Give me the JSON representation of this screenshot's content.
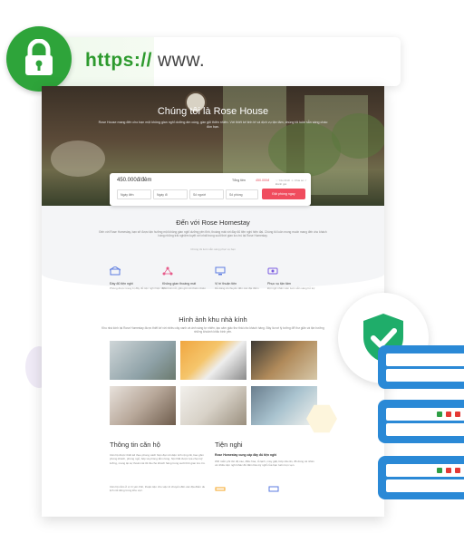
{
  "url_bar": {
    "scheme": "https://",
    "domain": "www.",
    "lock_icon": "lock-icon"
  },
  "hero": {
    "title": "Chúng tôi là Rose House",
    "subtitle": "Rose House mang đến cho bạn một không gian nghỉ dưỡng ấm cúng, gần gũi thiên nhiên. Với thiết kế tinh tế và dịch vụ tận tâm, chúng tôi luôn sẵn sàng chào đón bạn."
  },
  "booking": {
    "price": "450.000đ/đêm",
    "total_label": "Tổng tiền",
    "total_value": "450.000đ",
    "links": "♡ Yêu thích   ☺ Chia sẻ   ☆ Đánh giá",
    "fields": [
      "Ngày đến",
      "Ngày đi",
      "Số người",
      "Số phòng"
    ],
    "button": "Đặt phòng ngay"
  },
  "intro": {
    "title": "Đến với Rose Homestay",
    "text": "Đến với Rose Homestay, bạn sẽ được tận hưởng một không gian nghỉ dưỡng yên tĩnh, thoáng mát với đầy đủ tiện nghi hiện đại. Chúng tôi luôn mong muốn mang đến cho khách hàng những trải nghiệm tuyệt vời nhất trong suốt thời gian lưu trú tại Rose Homestay.",
    "note": "Chúng tôi luôn sẵn sàng phục vụ bạn"
  },
  "features": [
    {
      "title": "Đầy đủ tiện nghi",
      "desc": "Phòng được trang bị đầy đủ tiện nghi hiện đại"
    },
    {
      "title": "Không gian thoáng mát",
      "desc": "Thiết kế mở, gần gũi với thiên nhiên"
    },
    {
      "title": "Vị trí thuận tiện",
      "desc": "Dễ dàng di chuyển đến các địa điểm"
    },
    {
      "title": "Phục vụ tận tâm",
      "desc": "Đội ngũ nhân viên luôn sẵn sàng hỗ trợ"
    }
  ],
  "gallery": {
    "title": "Hình ảnh khu nhà kính",
    "text": "Khu nhà kính tại Rose Homestay được thiết kế với nhiều cây xanh và ánh sáng tự nhiên, tạo cảm giác thư thái cho khách hàng. Đây là nơi lý tưởng để thư giãn và tận hưởng những khoảnh khắc bình yên."
  },
  "info": {
    "title": "Thông tin căn hộ",
    "text": "Căn hộ được thiết kế theo phong cách hiện đại với diện tích rộng rãi, bao gồm phòng khách, phòng ngủ, bếp và phòng tắm riêng. Nội thất được lựa chọn kỹ lưỡng, mang lại sự thoải mái tối đa cho khách hàng trong suốt thời gian lưu trú.",
    "text2": "Căn hộ nằm ở vị trí yên tĩnh, thuận tiện cho việc di chuyển đến các địa điểm du lịch nổi tiếng trong khu vực."
  },
  "amenities": {
    "title": "Tiện nghi",
    "subtitle": "Rose Homestay cung cấp đầy đủ tiện nghi",
    "text": "Wifi miễn phí tốc độ cao, điều hòa, tủ lạnh, máy giặt, bếp nấu ăn, đồ dùng cá nhân và nhiều tiện nghi khác để đảm bảo kỳ nghỉ của bạn luôn trọn vẹn."
  },
  "colors": {
    "green": "#2ea43a",
    "accent": "#f04c5e",
    "server_blue": "#2a89d6"
  }
}
